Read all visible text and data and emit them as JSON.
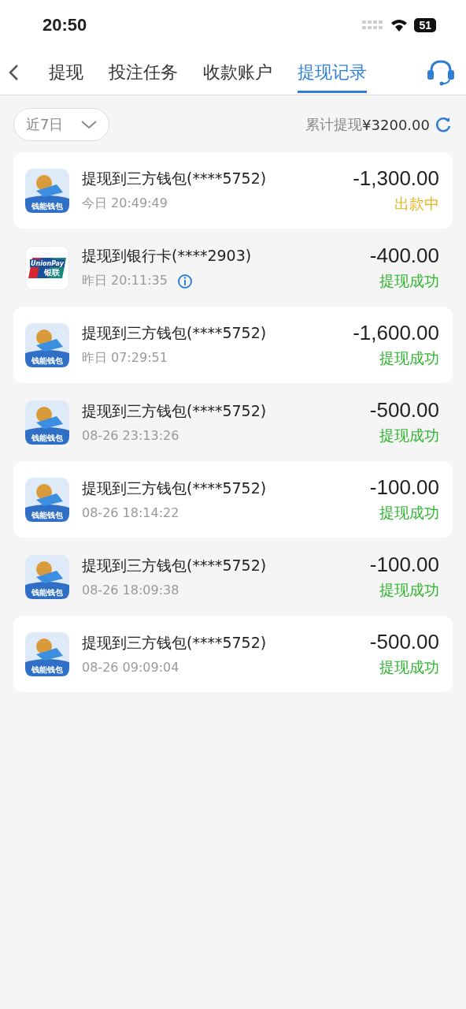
{
  "status_bar": {
    "time": "20:50",
    "battery": "51"
  },
  "tabs": [
    {
      "label": "提现",
      "selected": false
    },
    {
      "label": "投注任务",
      "selected": false
    },
    {
      "label": "收款账户",
      "selected": false
    },
    {
      "label": "提现记录",
      "selected": true
    }
  ],
  "filter": {
    "range": "近7日",
    "total_label": "累计提现",
    "total": "¥3200.00"
  },
  "records": [
    {
      "kind": "wallet",
      "logo_text": "钱能钱包",
      "title": "提现到三方钱包(****5752)",
      "time": "今日 20:49:49",
      "info": false,
      "amount": "-1,300.00",
      "status": "出款中",
      "color": "#e6b422"
    },
    {
      "kind": "bank",
      "logo_text": "UnionPay",
      "logo_text_2": "银联",
      "title": "提现到银行卡(****2903)",
      "time": "昨日 20:11:35",
      "info": true,
      "amount": "-400.00",
      "status": "提现成功",
      "color": "#2db52d"
    },
    {
      "kind": "wallet",
      "logo_text": "钱能钱包",
      "title": "提现到三方钱包(****5752)",
      "time": "昨日 07:29:51",
      "info": false,
      "amount": "-1,600.00",
      "status": "提现成功",
      "color": "#2db52d"
    },
    {
      "kind": "wallet",
      "logo_text": "钱能钱包",
      "title": "提现到三方钱包(****5752)",
      "time": "08-26 23:13:26",
      "info": false,
      "amount": "-500.00",
      "status": "提现成功",
      "color": "#2db52d"
    },
    {
      "kind": "wallet",
      "logo_text": "钱能钱包",
      "title": "提现到三方钱包(****5752)",
      "time": "08-26 18:14:22",
      "info": false,
      "amount": "-100.00",
      "status": "提现成功",
      "color": "#2db52d"
    },
    {
      "kind": "wallet",
      "logo_text": "钱能钱包",
      "title": "提现到三方钱包(****5752)",
      "time": "08-26 18:09:38",
      "info": false,
      "amount": "-100.00",
      "status": "提现成功",
      "color": "#2db52d"
    },
    {
      "kind": "wallet",
      "logo_text": "钱能钱包",
      "title": "提现到三方钱包(****5752)",
      "time": "08-26 09:09:04",
      "info": false,
      "amount": "-500.00",
      "status": "提现成功",
      "color": "#2db52d"
    }
  ]
}
